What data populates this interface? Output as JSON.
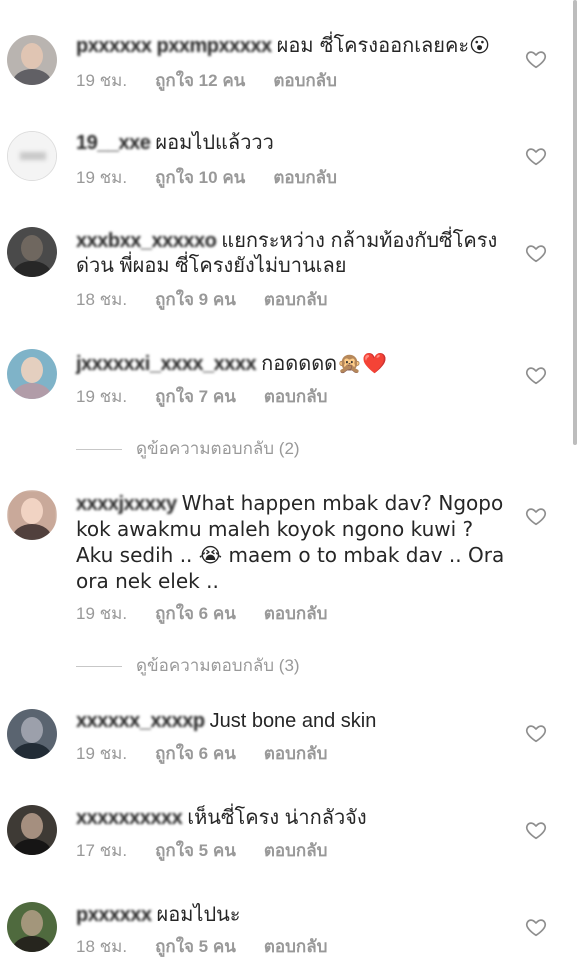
{
  "comments": [
    {
      "username": "pxxxxxx pxxmpxxxxx",
      "text": "ผอม ซี่โครงออกเลยคะ😮",
      "time": "19 ชม.",
      "likes": "ถูกใจ 12 คน",
      "reply": "ตอบกลับ",
      "avatar_color": "#b9b4b0"
    },
    {
      "username": "19__xxe",
      "text": "ผอมไปแล้ววว",
      "time": "19 ชม.",
      "likes": "ถูกใจ 10 คน",
      "reply": "ตอบกลับ",
      "avatar_color": "#eeeeee"
    },
    {
      "username": "xxxbxx_xxxxxo",
      "text": "แยกระหว่าง กล้ามท้องกับซี่โครง ด่วน พี่ผอม ซี่โครงยังไม่บานเลย",
      "time": "18 ชม.",
      "likes": "ถูกใจ 9 คน",
      "reply": "ตอบกลับ",
      "avatar_color": "#4a4a4a"
    },
    {
      "username": "jxxxxxxi_xxxx_xxxx",
      "text": "กอดดดด🙊❤️",
      "time": "19 ชม.",
      "likes": "ถูกใจ 7 คน",
      "reply": "ตอบกลับ",
      "avatar_color": "#7fb3c8"
    },
    {
      "username": "xxxxjxxxxy",
      "text": "What happen mbak dav? Ngopo kok awakmu maleh koyok ngono kuwi ? Aku sedih .. 😭 maem o to mbak dav .. Ora ora nek elek ..",
      "time": "19 ชม.",
      "likes": "ถูกใจ 6 คน",
      "reply": "ตอบกลับ",
      "avatar_color": "#c9a99a"
    },
    {
      "username": "xxxxxx_xxxxp",
      "text": "Just bone and skin",
      "time": "19 ชม.",
      "likes": "ถูกใจ 6 คน",
      "reply": "ตอบกลับ",
      "avatar_color": "#5a6470"
    },
    {
      "username": "xxxxxxxxxx",
      "text": "เห็นซี่โครง น่ากลัวจัง",
      "time": "17 ชม.",
      "likes": "ถูกใจ 5 คน",
      "reply": "ตอบกลับ",
      "avatar_color": "#3e3a35"
    },
    {
      "username": "pxxxxxx",
      "text": "ผอมไปนะ",
      "time": "18 ชม.",
      "likes": "ถูกใจ 5 คน",
      "reply": "ตอบกลับ",
      "avatar_color": "#4f6a3e"
    }
  ],
  "view_replies": [
    {
      "label": "ดูข้อความตอบกลับ (2)"
    },
    {
      "label": "ดูข้อความตอบกลับ (3)"
    }
  ],
  "colors": {
    "text": "#262626",
    "meta": "#999999",
    "heart_outline": "#8e8e8e"
  },
  "icons": {
    "like": "heart-outline-icon"
  }
}
